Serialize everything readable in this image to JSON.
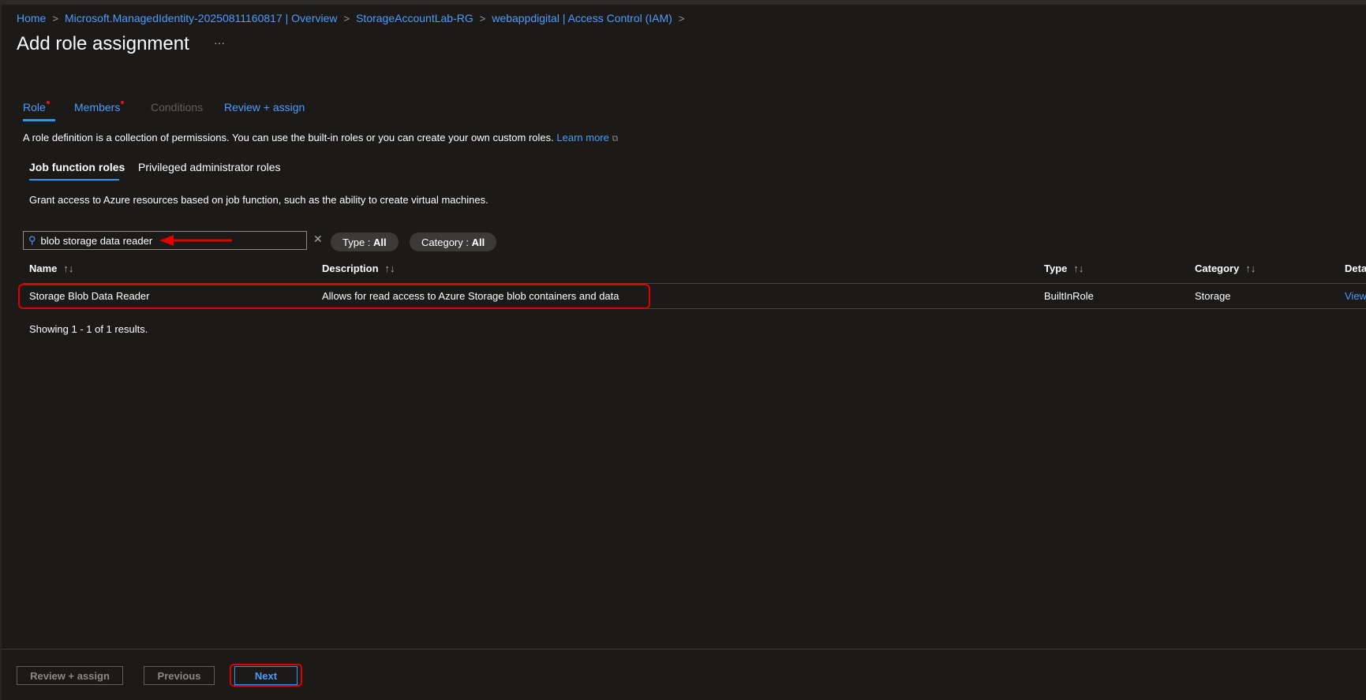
{
  "breadcrumb": [
    "Home",
    "Microsoft.ManagedIdentity-20250811160817 | Overview",
    "StorageAccountLab-RG",
    "webappdigital | Access Control (IAM)"
  ],
  "title": "Add role assignment",
  "more": "···",
  "tabs": [
    {
      "label": "Role",
      "required": true
    },
    {
      "label": "Members",
      "required": true
    },
    {
      "label": "Conditions"
    },
    {
      "label": "Review + assign"
    }
  ],
  "description": "A role definition is a collection of permissions. You can use the built-in roles or you can create your own custom roles.",
  "learn_more": "Learn more",
  "subtabs": [
    "Job function roles",
    "Privileged administrator roles"
  ],
  "subtab_desc": "Grant access to Azure resources based on job function, such as the ability to create virtual machines.",
  "search": {
    "value": "blob storage data reader"
  },
  "filters": {
    "type_label": "Type : ",
    "type_value": "All",
    "category_label": "Category : ",
    "category_value": "All"
  },
  "table": {
    "headers": [
      "Name",
      "Description",
      "Type",
      "Category",
      "Deta"
    ],
    "sort": "↑↓",
    "rows": [
      {
        "name": "Storage Blob Data Reader",
        "description": "Allows for read access to Azure Storage blob containers and data",
        "type": "BuiltInRole",
        "category": "Storage",
        "details": "View"
      }
    ]
  },
  "results": "Showing 1 - 1 of 1 results.",
  "footer": {
    "review": "Review + assign",
    "previous": "Previous",
    "next": "Next"
  },
  "colors": {
    "accent": "#2899f5",
    "annotation": "#e00000"
  }
}
